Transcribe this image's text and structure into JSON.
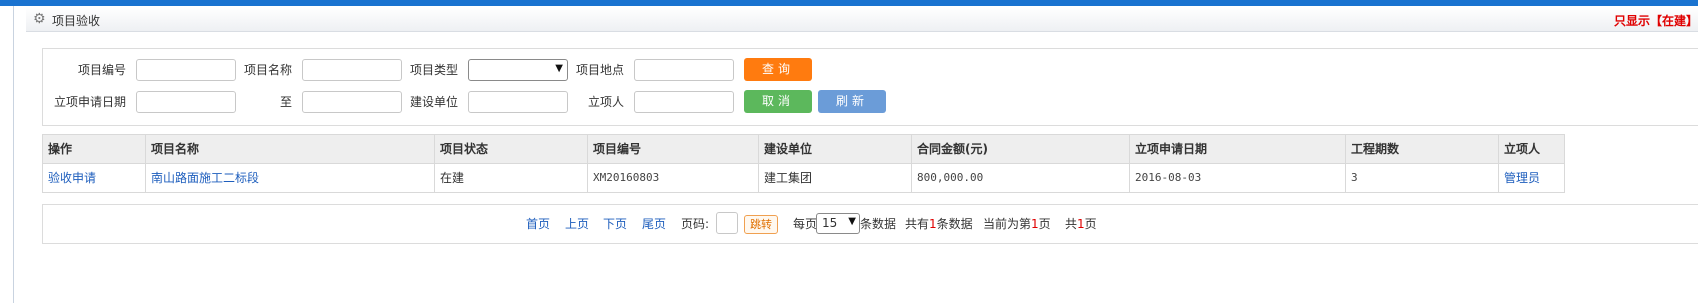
{
  "header": {
    "title": "项目验收",
    "notice": "只显示【在建】工程"
  },
  "search": {
    "project_code_label": "项目编号",
    "project_name_label": "项目名称",
    "project_type_label": "项目类型",
    "project_location_label": "项目地点",
    "apply_date_label": "立项申请日期",
    "to_label": "至",
    "builder_label": "建设单位",
    "creator_label": "立项人",
    "project_type_selected": "",
    "query_button": "查询",
    "cancel_button": "取消",
    "refresh_button": "刷新"
  },
  "table": {
    "columns": [
      "操作",
      "项目名称",
      "项目状态",
      "项目编号",
      "建设单位",
      "合同金额(元)",
      "立项申请日期",
      "工程期数",
      "立项人"
    ],
    "rows": [
      [
        "验收申请",
        "南山路面施工二标段",
        "在建",
        "XM20160803",
        "建工集团",
        "800,000.00",
        "2016-08-03",
        "3",
        "管理员"
      ]
    ]
  },
  "pager": {
    "first": "首页",
    "prev": "上页",
    "next": "下页",
    "last": "尾页",
    "page_label": "页码:",
    "jump": "跳转",
    "per_page_prefix": "每页",
    "per_page_value": "15",
    "per_page_suffix": "条数据",
    "total_prefix": "共有",
    "total_count": "1",
    "total_suffix": "条数据",
    "current_prefix": "当前为第",
    "current_page": "1",
    "current_suffix": "页",
    "pages_prefix": "共",
    "pages_count": "1",
    "pages_suffix": "页"
  },
  "colors": {
    "topbar": "#1a73d0",
    "query": "#ff7b0f",
    "cancel": "#5cb85c",
    "refresh": "#6b9cd8",
    "notice": "#e00000",
    "link": "#1e5ebd"
  }
}
